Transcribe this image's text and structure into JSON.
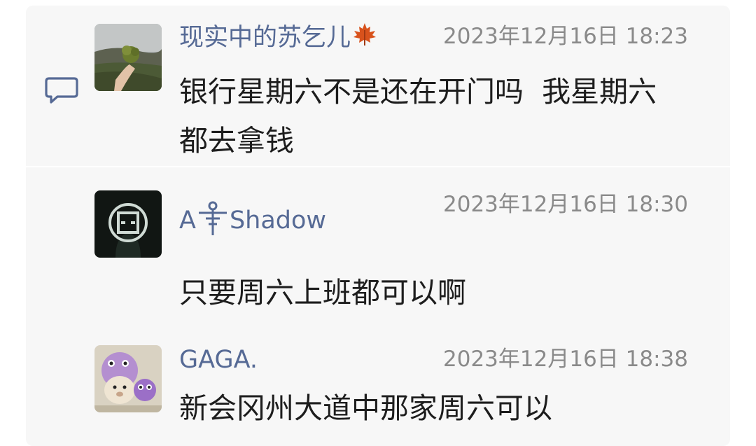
{
  "comments": [
    {
      "author": "现实中的苏乞儿",
      "author_emoji": "maple-leaf-icon",
      "time": "2023年12月16日 18:23",
      "text_line1": "银行星期六不是还在开门吗  我星期六",
      "text_line2": "都去拿钱"
    },
    {
      "author_prefix": "A",
      "author_emoji": "scarecrow-symbol-icon",
      "author_suffix": "Shadow",
      "time": "2023年12月16日 18:30",
      "text": "只要周六上班都可以啊"
    },
    {
      "author": "GAGA.",
      "time": "2023年12月16日 18:38",
      "text": "新会冈州大道中那家周六可以"
    }
  ],
  "colors": {
    "author": "#566a95",
    "timestamp": "#8a8a8a",
    "text": "#1d1d1d",
    "panel_bg": "#f7f7f7"
  },
  "icons": [
    "comment-bubble-icon"
  ]
}
